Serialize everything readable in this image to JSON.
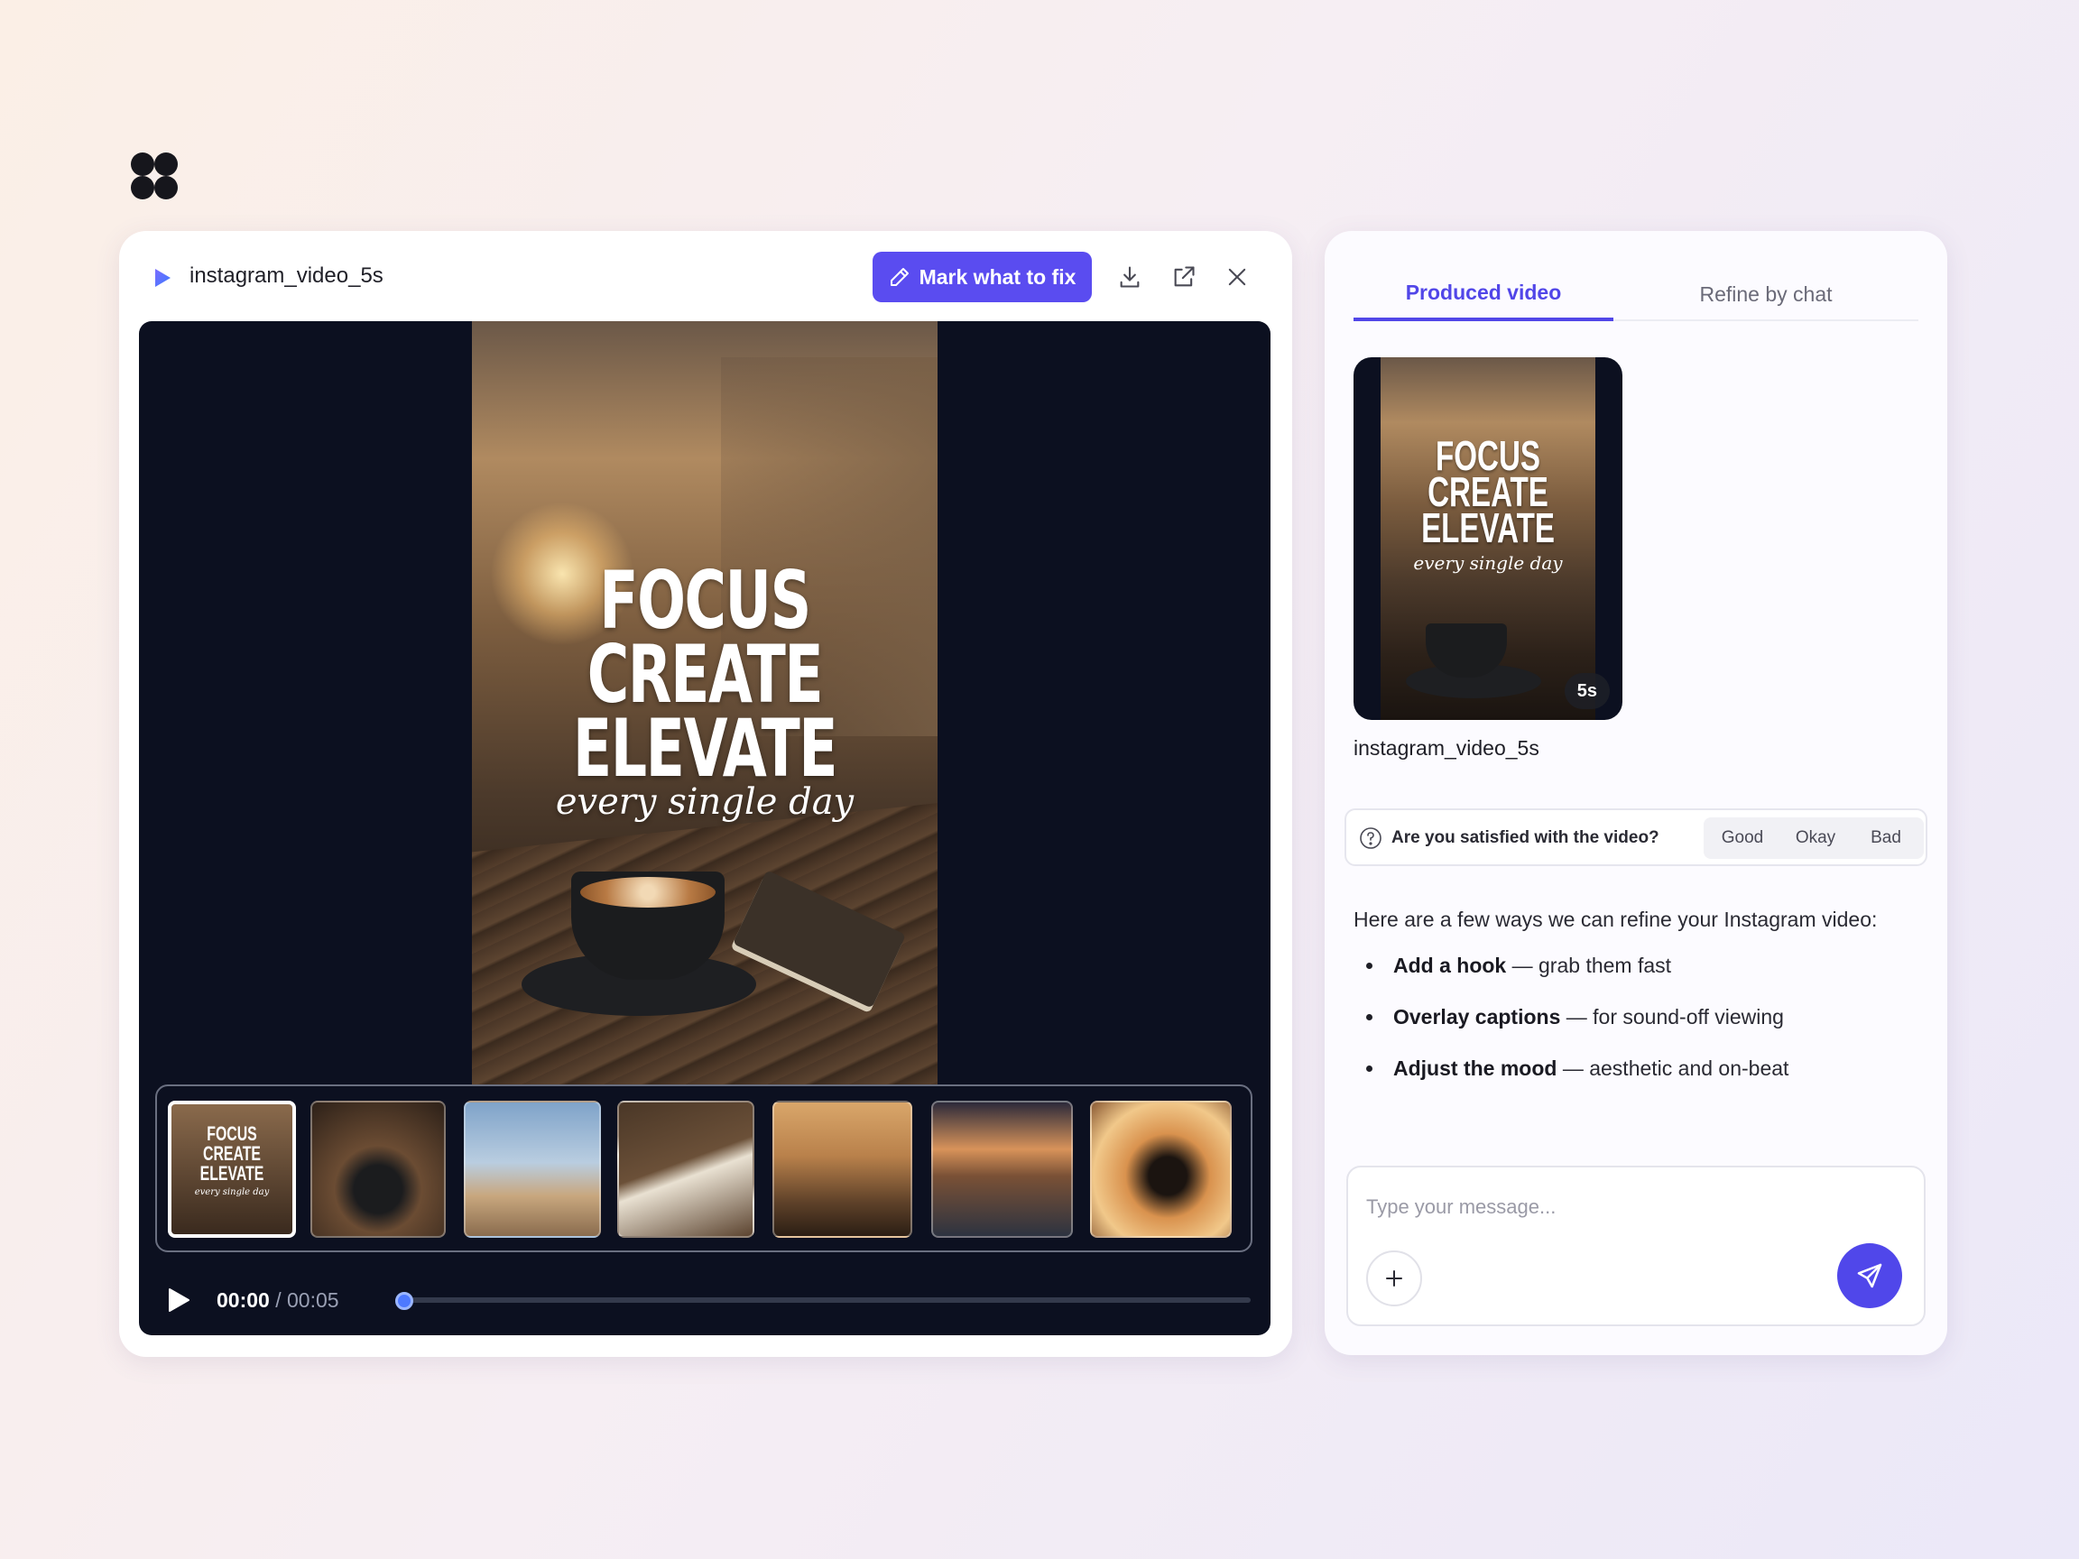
{
  "app": {
    "logo_icon": "four-petal-logo-icon"
  },
  "player_panel": {
    "file_name": "instagram_video_5s",
    "fix_button_label": "Mark what to fix",
    "icons": [
      "download-icon",
      "open-external-icon",
      "close-icon"
    ],
    "accent_color": "#5a4cf0",
    "overlay": {
      "line1": "FOCUS",
      "line2": "CREATE",
      "line3": "ELEVATE",
      "subline": "every single day"
    },
    "thumbnail_count": 7,
    "selected_thumbnail": 1,
    "current_time": "00:00",
    "separator": "/",
    "total_time": "00:05",
    "progress": 0.0
  },
  "side_panel": {
    "tabs": [
      {
        "label": "Produced video",
        "active": true
      },
      {
        "label": "Refine by chat",
        "active": false
      }
    ],
    "video_card": {
      "duration": "5s",
      "title": "instagram_video_5s"
    },
    "feedback": {
      "question": "Are you satisfied with the video?",
      "options": [
        "Good",
        "Okay",
        "Bad"
      ]
    },
    "intro": "Here are a few ways we can refine your Instagram video:",
    "suggestions": [
      {
        "title": "Add a hook",
        "detail": " — grab them fast"
      },
      {
        "title": "Overlay captions",
        "detail": " — for sound-off viewing"
      },
      {
        "title": "Adjust the mood",
        "detail": " — aesthetic and on-beat"
      }
    ],
    "composer": {
      "placeholder": "Type your message...",
      "value": ""
    }
  }
}
